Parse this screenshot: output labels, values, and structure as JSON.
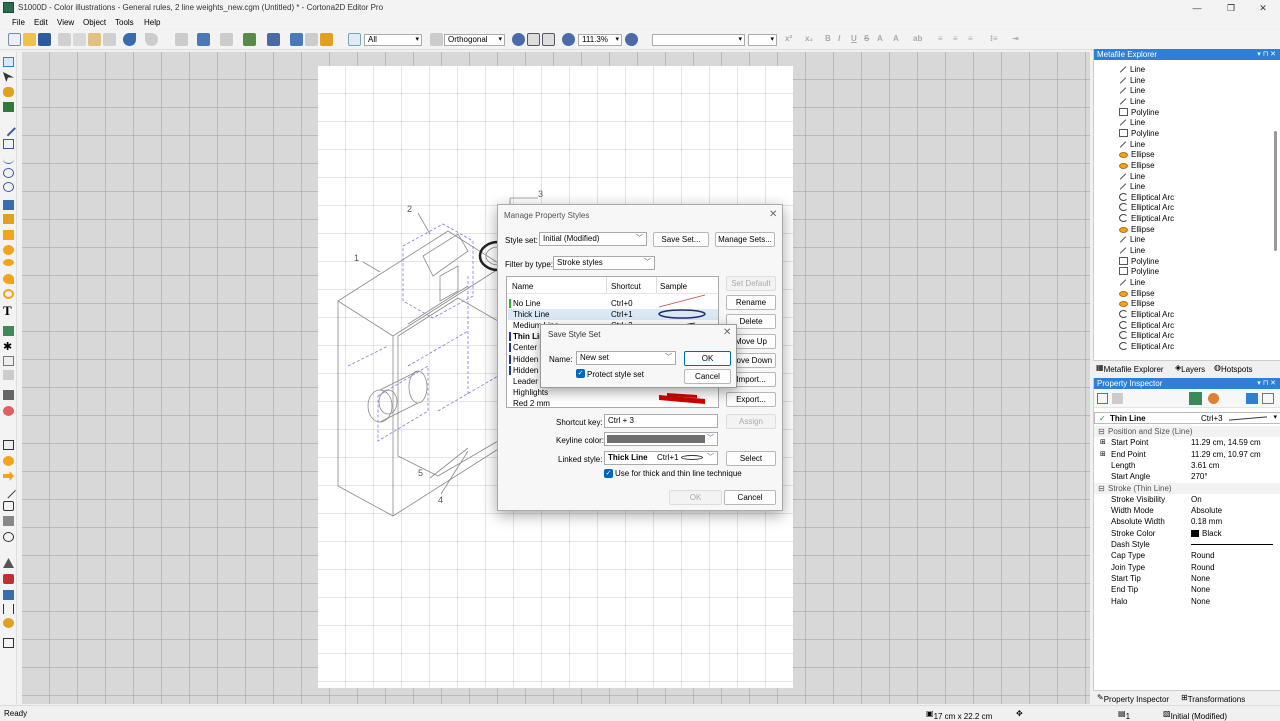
{
  "window": {
    "title": "S1000D - Color illustrations - General rules, 2 line weights_new.cgm (Untitled) * - Cortona2D Editor Pro"
  },
  "menu": [
    "File",
    "Edit",
    "View",
    "Object",
    "Tools",
    "Help"
  ],
  "toolbar": {
    "layer_select": "All",
    "projection_select": "Orthogonal",
    "zoom": "111.3%"
  },
  "drawing": {
    "callouts": [
      "1",
      "2",
      "3",
      "4",
      "5"
    ]
  },
  "explorer": {
    "title": "Metafile Explorer",
    "items": [
      {
        "label": "Line",
        "icon": "line-icon"
      },
      {
        "label": "Line",
        "icon": "line-icon"
      },
      {
        "label": "Line",
        "icon": "line-icon"
      },
      {
        "label": "Line",
        "icon": "line-icon"
      },
      {
        "label": "Polyline",
        "icon": "polyline-icon"
      },
      {
        "label": "Line",
        "icon": "line-icon"
      },
      {
        "label": "Polyline",
        "icon": "polyline-icon"
      },
      {
        "label": "Line",
        "icon": "line-icon"
      },
      {
        "label": "Ellipse",
        "icon": "ellipse-icon"
      },
      {
        "label": "Ellipse",
        "icon": "ellipse-icon"
      },
      {
        "label": "Line",
        "icon": "line-icon"
      },
      {
        "label": "Line",
        "icon": "line-icon"
      },
      {
        "label": "Elliptical Arc",
        "icon": "elliptical-arc-icon"
      },
      {
        "label": "Elliptical Arc",
        "icon": "elliptical-arc-icon"
      },
      {
        "label": "Elliptical Arc",
        "icon": "elliptical-arc-icon"
      },
      {
        "label": "Ellipse",
        "icon": "ellipse-icon"
      },
      {
        "label": "Line",
        "icon": "line-icon"
      },
      {
        "label": "Line",
        "icon": "line-icon"
      },
      {
        "label": "Polyline",
        "icon": "polyline-icon"
      },
      {
        "label": "Polyline",
        "icon": "polyline-icon"
      },
      {
        "label": "Line",
        "icon": "line-icon"
      },
      {
        "label": "Ellipse",
        "icon": "ellipse-icon"
      },
      {
        "label": "Ellipse",
        "icon": "ellipse-icon"
      },
      {
        "label": "Elliptical Arc",
        "icon": "elliptical-arc-icon"
      },
      {
        "label": "Elliptical Arc",
        "icon": "elliptical-arc-icon"
      },
      {
        "label": "Elliptical Arc",
        "icon": "elliptical-arc-icon"
      },
      {
        "label": "Elliptical Arc",
        "icon": "elliptical-arc-icon"
      }
    ],
    "tabs": [
      "Metafile Explorer",
      "Layers",
      "Hotspots"
    ]
  },
  "inspector": {
    "title": "Property Inspector",
    "style_name": "Thin Line",
    "style_shortcut": "Ctrl+3",
    "rows": [
      {
        "key": "Position and Size (Line)",
        "value": "",
        "group": true
      },
      {
        "key": "Start Point",
        "value": "11.29 cm, 14.59 cm",
        "group": false
      },
      {
        "key": "End Point",
        "value": "11.29 cm, 10.97 cm",
        "group": false
      },
      {
        "key": "Length",
        "value": "3.61 cm",
        "group": false
      },
      {
        "key": "Start Angle",
        "value": "270°",
        "group": false
      },
      {
        "key": "Stroke (Thin Line)",
        "value": "",
        "group": true
      },
      {
        "key": "Stroke Visibility",
        "value": "On",
        "group": false
      },
      {
        "key": "Width Mode",
        "value": "Absolute",
        "group": false
      },
      {
        "key": "Absolute Width",
        "value": "0.18 mm",
        "group": false
      },
      {
        "key": "Stroke Color",
        "value": "Black",
        "group": false
      },
      {
        "key": "Dash Style",
        "value": "",
        "group": false
      },
      {
        "key": "Cap Type",
        "value": "Round",
        "group": false
      },
      {
        "key": "Join Type",
        "value": "Round",
        "group": false
      },
      {
        "key": "Start Tip",
        "value": "None",
        "group": false
      },
      {
        "key": "End Tip",
        "value": "None",
        "group": false
      },
      {
        "key": "Halo",
        "value": "None",
        "group": false
      }
    ],
    "tabs": [
      "Property Inspector",
      "Transformations"
    ]
  },
  "status": {
    "left": "Ready",
    "page_size": "17 cm x 22.2 cm",
    "layer": "1",
    "style_set": "Initial (Modified)"
  },
  "dialog": {
    "title": "Manage Property Styles",
    "style_set_label": "Style set:",
    "style_set_value": "Initial (Modified)",
    "save_set": "Save Set...",
    "manage_sets": "Manage Sets...",
    "filter_label": "Filter by type:",
    "filter_value": "Stroke styles",
    "columns": {
      "name": "Name",
      "shortcut": "Shortcut",
      "sample": "Sample"
    },
    "rows": [
      {
        "name": "No Line",
        "shortcut": "Ctrl+0",
        "mark": "#2bb42b",
        "bold": false
      },
      {
        "name": "Thick Line",
        "shortcut": "Ctrl+1",
        "mark": "",
        "bold": false
      },
      {
        "name": "Medium Line",
        "shortcut": "Ctrl+2",
        "mark": "",
        "bold": false
      },
      {
        "name": "Thin Line",
        "shortcut": "",
        "mark": "#2233aa",
        "bold": true
      },
      {
        "name": "Center Li",
        "shortcut": "",
        "mark": "#2233aa",
        "bold": false
      },
      {
        "name": "Hidden Li",
        "shortcut": "",
        "mark": "#2233aa",
        "bold": false
      },
      {
        "name": "Hidden Li",
        "shortcut": "",
        "mark": "#2233aa",
        "bold": false
      },
      {
        "name": "Leader Li",
        "shortcut": "",
        "mark": "",
        "bold": false
      },
      {
        "name": "Highlights",
        "shortcut": "",
        "mark": "",
        "bold": false
      },
      {
        "name": "Red 2 mm",
        "shortcut": "",
        "mark": "",
        "bold": false
      }
    ],
    "buttons": {
      "set_default": "Set Default",
      "rename": "Rename",
      "delete": "Delete",
      "move_up": "Move Up",
      "move_down": "Move Down",
      "import": "Import...",
      "export": "Export...",
      "assign": "Assign",
      "select": "Select",
      "ok": "OK",
      "cancel": "Cancel"
    },
    "shortcut_label": "Shortcut key:",
    "shortcut_value": "Ctrl + 3",
    "keyline_label": "Keyline color:",
    "linked_label": "Linked style:",
    "linked_value": "Thick Line",
    "linked_shortcut": "Ctrl+1",
    "thick_thin_label": "Use for thick and thin line technique"
  },
  "save_dialog": {
    "title": "Save Style Set",
    "name_label": "Name:",
    "name_value": "New set",
    "protect_label": "Protect style set",
    "ok": "OK",
    "cancel": "Cancel"
  },
  "colors": {
    "accent": "#2f7fd4",
    "selection": "#dbe9f7",
    "keyline": "#6e6e6e",
    "red_sample": "#d00000"
  }
}
